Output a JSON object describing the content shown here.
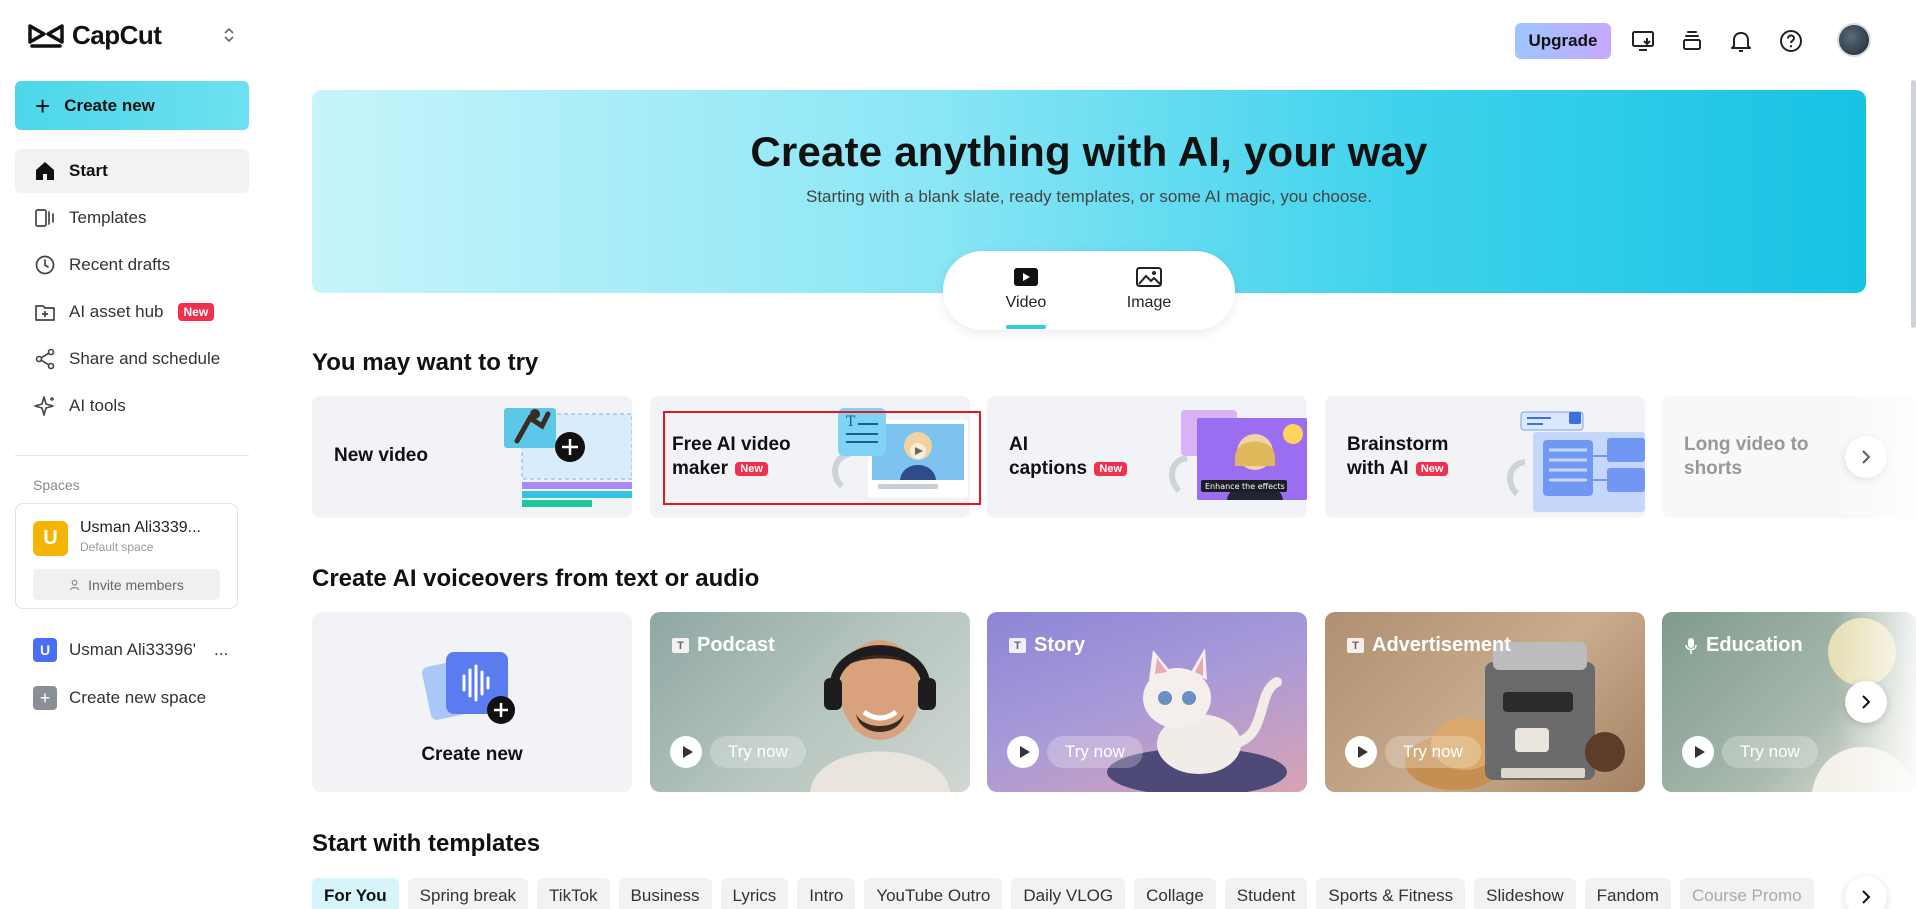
{
  "app": {
    "name": "CapCut"
  },
  "sidebar": {
    "create_label": "Create new",
    "items": [
      {
        "label": "Start",
        "icon": "home-icon",
        "active": true
      },
      {
        "label": "Templates",
        "icon": "templates-icon"
      },
      {
        "label": "Recent drafts",
        "icon": "clock-icon"
      },
      {
        "label": "AI asset hub",
        "icon": "folder-plus-icon",
        "badge": "New"
      },
      {
        "label": "Share and schedule",
        "icon": "share-icon"
      },
      {
        "label": "AI tools",
        "icon": "sparkle-icon"
      }
    ],
    "spaces_label": "Spaces",
    "space": {
      "initial": "U",
      "name": "Usman Ali3339...",
      "sub": "Default space",
      "invite": "Invite members"
    },
    "space2": {
      "initial": "U",
      "name": "Usman Ali33396'",
      "more": "..."
    },
    "new_space": "Create new space"
  },
  "topbar": {
    "upgrade": "Upgrade"
  },
  "hero": {
    "title": "Create anything with AI, your way",
    "subtitle": "Starting with a blank slate, ready templates, or some AI magic, you choose.",
    "tabs": [
      {
        "label": "Video",
        "active": true
      },
      {
        "label": "Image"
      }
    ]
  },
  "try_section": {
    "title": "You may want to try",
    "cards": [
      {
        "label": "New video"
      },
      {
        "label_line1": "Free AI video",
        "label_line2": "maker",
        "badge": "New"
      },
      {
        "label_line1": "AI",
        "label_line2": "captions",
        "badge": "New",
        "overlay_text": "Enhance the effects"
      },
      {
        "label_line1": "Brainstorm",
        "label_line2": "with AI",
        "badge": "New"
      },
      {
        "label_line1": "Long video to",
        "label_line2": "shorts"
      }
    ]
  },
  "voiceover_section": {
    "title": "Create AI voiceovers from text or audio",
    "create_label": "Create new",
    "cards": [
      {
        "title": "Podcast",
        "cta": "Try now"
      },
      {
        "title": "Story",
        "cta": "Try now"
      },
      {
        "title": "Advertisement",
        "cta": "Try now"
      },
      {
        "title": "Education",
        "cta": "Try now"
      }
    ]
  },
  "templates_section": {
    "title": "Start with templates",
    "chips": [
      "For You",
      "Spring break",
      "TikTok",
      "Business",
      "Lyrics",
      "Intro",
      "YouTube Outro",
      "Daily VLOG",
      "Collage",
      "Student",
      "Sports & Fitness",
      "Slideshow",
      "Fandom",
      "Course Promo"
    ]
  },
  "colors": {
    "accent": "#2fcbe4",
    "new_badge": "#f0314d",
    "highlight": "#e8161f"
  }
}
